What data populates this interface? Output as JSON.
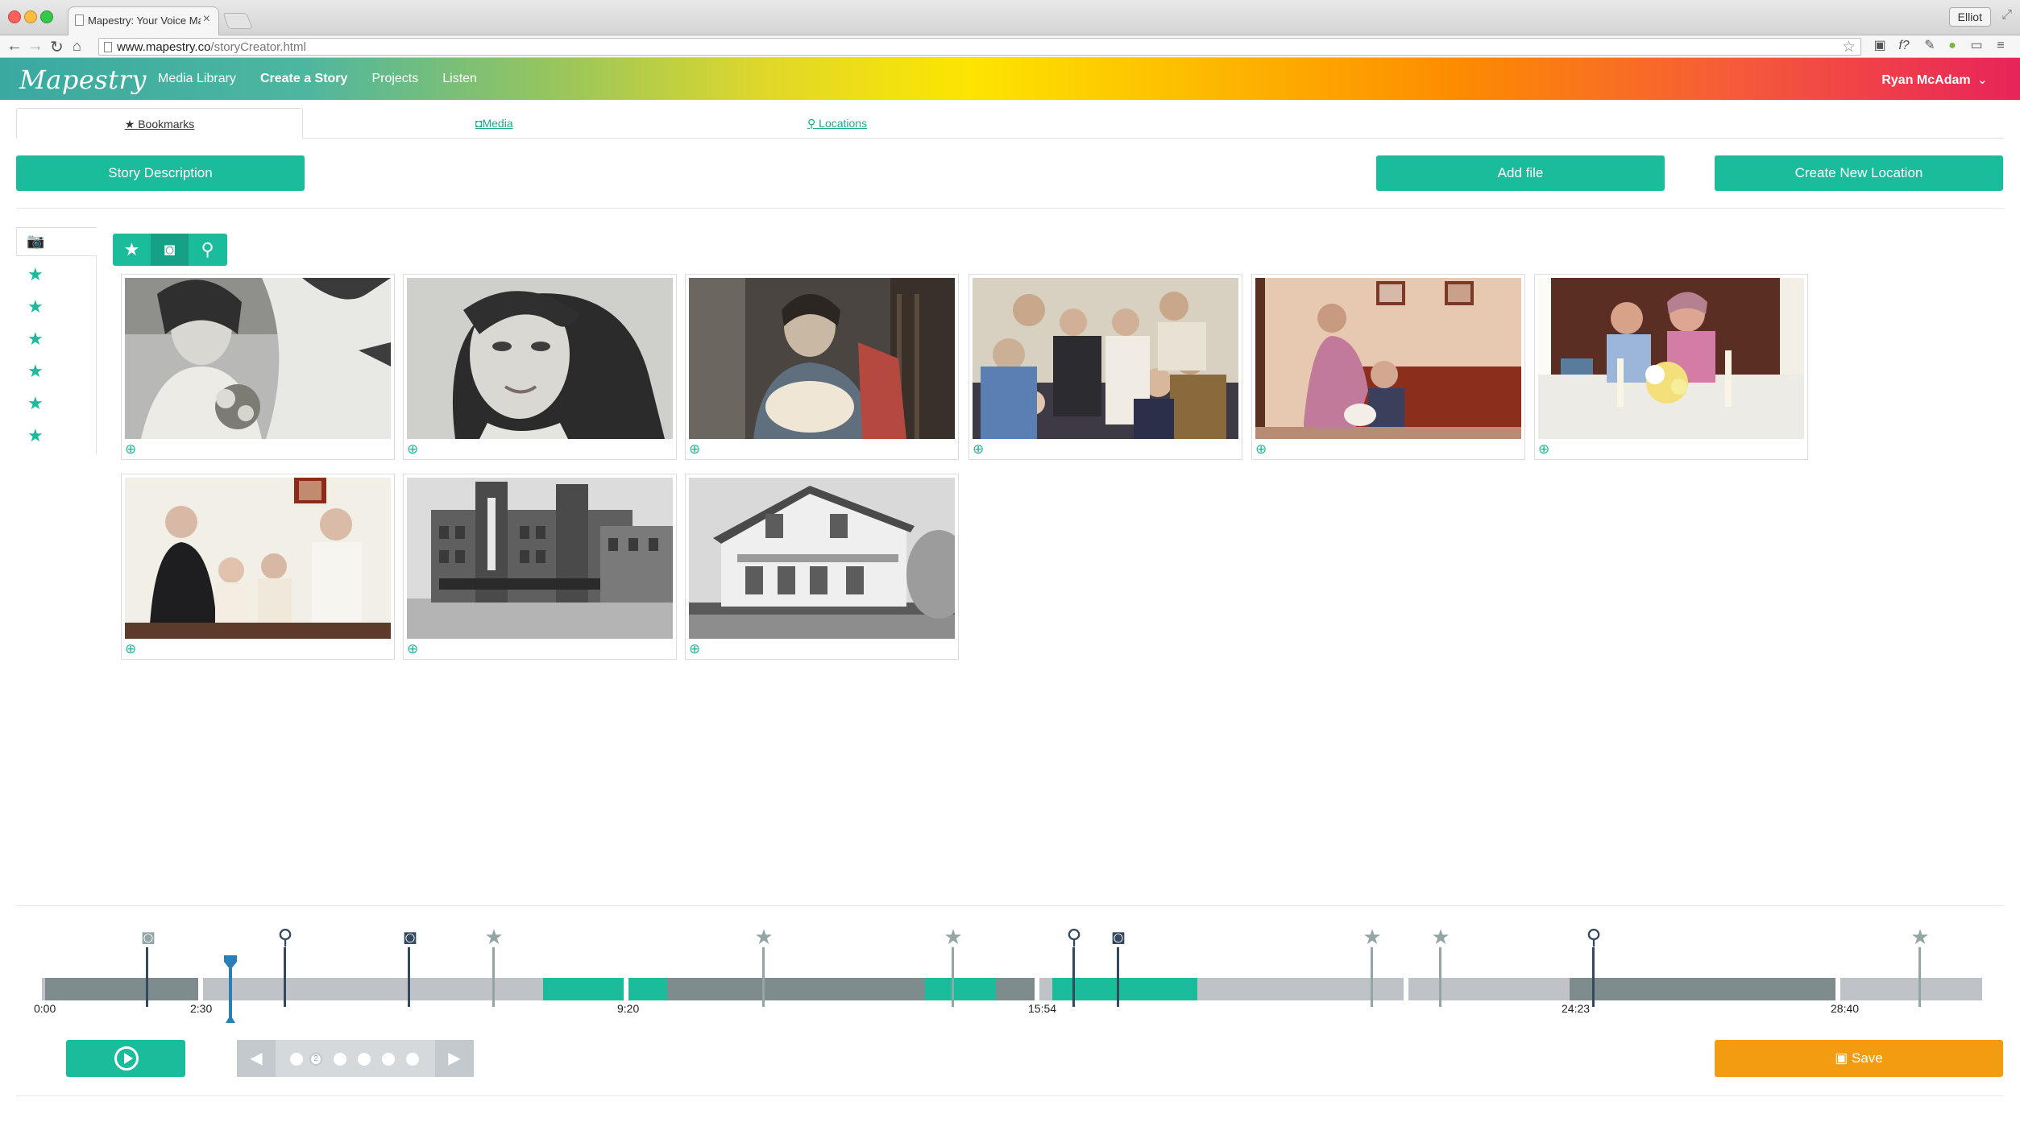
{
  "browser": {
    "tab_title": "Mapestry: Your Voice Matt",
    "url_host": "www.mapestry.co",
    "url_path": "/storyCreator.html",
    "profile": "Elliot"
  },
  "header": {
    "logo": "Mapestry",
    "nav": [
      "Media Library",
      "Create a Story",
      "Projects",
      "Listen"
    ],
    "user": "Ryan McAdam"
  },
  "tabs": {
    "bookmarks": "Bookmarks",
    "media": "Media",
    "locations": "Locations"
  },
  "buttons": {
    "story_description": "Story Description",
    "add_file": "Add file",
    "create_location": "Create New Location",
    "save": "Save"
  },
  "colors": {
    "accent": "#1abc9c",
    "accent_dark": "#16a085",
    "save": "#f39c12",
    "track": "#bfc3c7",
    "segment_dark": "#7f8c8d",
    "marker_dark": "#34495e",
    "marker_light": "#95a5a6"
  },
  "rail": {
    "header_icon": "camera-icon",
    "star_count": 6
  },
  "photos": [
    {
      "name": "photo-bride-bouquet",
      "tone": "bw"
    },
    {
      "name": "photo-woman-portrait",
      "tone": "bw"
    },
    {
      "name": "photo-woman-baby-rocking-chair",
      "tone": "color"
    },
    {
      "name": "photo-family-group",
      "tone": "color"
    },
    {
      "name": "photo-living-room-family",
      "tone": "color"
    },
    {
      "name": "photo-couple-dinner-table",
      "tone": "color"
    },
    {
      "name": "photo-parents-two-girls",
      "tone": "color"
    },
    {
      "name": "photo-paramount-theater",
      "tone": "bw"
    },
    {
      "name": "photo-white-house",
      "tone": "bw"
    }
  ],
  "timeline": {
    "time_labels": [
      "0:00",
      "2:30",
      "9:20",
      "15:54",
      "24:23",
      "28:40"
    ],
    "markers": [
      {
        "type": "camera",
        "style": "light"
      },
      {
        "type": "location",
        "style": "dark"
      },
      {
        "type": "camera",
        "style": "dark"
      },
      {
        "type": "star",
        "style": "light"
      },
      {
        "type": "star",
        "style": "light"
      },
      {
        "type": "star",
        "style": "light"
      },
      {
        "type": "location",
        "style": "dark"
      },
      {
        "type": "camera",
        "style": "dark"
      },
      {
        "type": "star",
        "style": "light"
      },
      {
        "type": "star",
        "style": "light"
      },
      {
        "type": "location",
        "style": "dark"
      },
      {
        "type": "star",
        "style": "light"
      }
    ]
  },
  "pager": {
    "current_page": "2"
  }
}
